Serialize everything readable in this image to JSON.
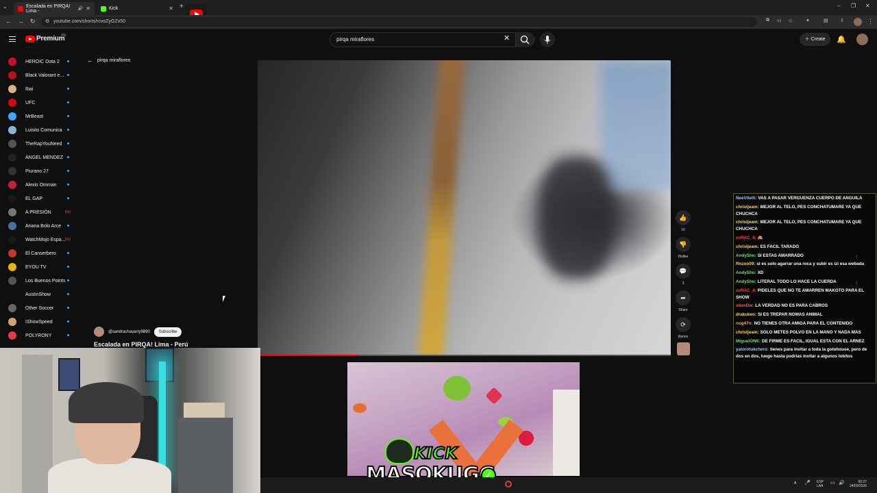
{
  "browser": {
    "tabs": [
      {
        "title": "Escalada en PIRQA! Lima -",
        "active": true
      },
      {
        "title": "Kick",
        "active": false
      }
    ],
    "new_tab_label": "+",
    "url": "youtube.com/shorts/rcvoZyGZv50",
    "controls": {
      "minimize": "–",
      "maximize": "❐",
      "close": "✕"
    }
  },
  "youtube": {
    "logo_text": "Premium",
    "logo_region": "PE",
    "search_query": "pirqa miraflores",
    "create_label": "Create",
    "colors": {
      "brand_red": "#ff0000",
      "accent_blue": "#3ea6ff"
    }
  },
  "sidebar": {
    "subscriptions": [
      {
        "name": "HEROIC Dota 2",
        "color": "#c8102e"
      },
      {
        "name": "Black Valorant e...",
        "color": "#b5111a"
      },
      {
        "name": "Ibai",
        "color": "#d9b48a"
      },
      {
        "name": "UFC",
        "color": "#d20a0a"
      },
      {
        "name": "MrBeast",
        "color": "#3ea6ff"
      },
      {
        "name": "Luisito Comunica",
        "color": "#8cb4d8"
      },
      {
        "name": "TheRapYouNeed",
        "color": "#555555"
      },
      {
        "name": "ANGEL MENDEZ",
        "color": "#222222"
      },
      {
        "name": "Piurano 27",
        "color": "#333333"
      },
      {
        "name": "Alexis Omman",
        "color": "#c41e3a"
      },
      {
        "name": "EL GAP",
        "color": "#1a1a1a"
      },
      {
        "name": "A PRESIÓN",
        "color": "#777777",
        "live": true
      },
      {
        "name": "Ariana Bolo Arce",
        "color": "#4a6fa5"
      },
      {
        "name": "WatchMojo Espa...",
        "color": "#1a1a1a",
        "live": true
      },
      {
        "name": "El Canserbero",
        "color": "#c0392b"
      },
      {
        "name": "EYOU TV",
        "color": "#e6b800"
      },
      {
        "name": "Los Buenos Points",
        "color": "#555555"
      },
      {
        "name": "AustinShow",
        "color": "#0f0f0f"
      },
      {
        "name": "Other Soccer",
        "color": "#666666"
      },
      {
        "name": "IShowSpeed",
        "color": "#d4a373"
      },
      {
        "name": "POLYRONY",
        "color": "#e63946"
      }
    ]
  },
  "shorts": {
    "back_label": "pirqa miraflores",
    "channel_handle": "@sandrachavarry9890",
    "subscribe_label": "Subscribe",
    "title": "Escalada en PIRQA! Lima - Perú",
    "progress": 0.24,
    "actions": {
      "like_count": "10",
      "dislike_label": "Dislike",
      "comment_count": "3",
      "share_label": "Share",
      "remix_label": "Remix"
    }
  },
  "overlay": {
    "kick_label": "KICK",
    "streamer_name": "MASOKUGG",
    "kick_color": "#53fc18"
  },
  "chat": {
    "messages": [
      {
        "user": "NeeVitelli:",
        "text": "VAS A PASAR VERGUENZA CUERPO DE ANGUILA",
        "color": "#9ac8ff"
      },
      {
        "user": "christjeam:",
        "text": "MEJOR AL TELO, PES CONCHATUMARE YA QUE CHUCHCA",
        "color": "#f7d774"
      },
      {
        "user": "christjeam:",
        "text": "MEJOR AL TELO, PES CONCHATUMARE YA QUE CHUCHCA",
        "color": "#f7d774"
      },
      {
        "user": "zoRAC_4:",
        "text": "🙈",
        "color": "#ff4040"
      },
      {
        "user": "christjeam:",
        "text": "ES FACIL TARADO",
        "color": "#f7d774"
      },
      {
        "user": "AndySho:",
        "text": "SI ESTAS AMARRADO",
        "color": "#6ee06e"
      },
      {
        "user": "Rnzoo09:",
        "text": "si es solo agarrar una roca y subir es izi esa webada",
        "color": "#f7d774"
      },
      {
        "user": "AndySho:",
        "text": "XD",
        "color": "#6ee06e"
      },
      {
        "user": "AndySho:",
        "text": "LITERAL TODO LO HACE LA CUERDA",
        "color": "#6ee06e"
      },
      {
        "user": "zoRAC_4:",
        "text": "PIDELES QUE NO TE AMARREN MAKOTO PARA EL SHOW",
        "color": "#ff4040"
      },
      {
        "user": "shenDw:",
        "text": "LA VERDAD NO ES PARA CABROS",
        "color": "#ff5a5a"
      },
      {
        "user": "drakukeo:",
        "text": "SI ES TREPAR NOMAS ANIMAL",
        "color": "#f7d774"
      },
      {
        "user": "nog47n:",
        "text": "NO TIENES OTRA AMIGA PARA EL CONTENIDO",
        "color": "#f7a974"
      },
      {
        "user": "christjeam:",
        "text": "SOLO METES POLVO EN LA MANO Y NADA MAS",
        "color": "#f7d774"
      },
      {
        "user": "MiguelONK:",
        "text": "DE FIRME ES FACIL, IGUAL ESTA CON EL ARNEZ",
        "color": "#6ee06e"
      },
      {
        "user": "yatorotukchero:",
        "text": "tienes para invitar a toda la gotohouse, pero de dos en dos, luego hasta podrias invitar a algunos lobitos",
        "color": "#9ac8ff"
      }
    ]
  },
  "taskbar": {
    "lang": "ESP",
    "lang_sub": "LAA",
    "time": "00:27",
    "date": "24/03/2026"
  }
}
